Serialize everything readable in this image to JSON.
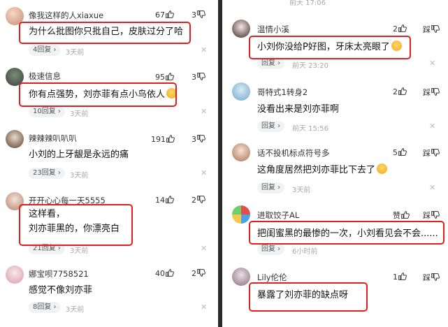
{
  "left": {
    "comments": [
      {
        "user": "像我这样的人xiaxue",
        "content": "为什么批图你只批自己，皮肤过分了哈",
        "replies": "4回复",
        "time": "3天前",
        "likes": "67",
        "dislikes": "3"
      },
      {
        "user": "极速信息",
        "content": "你有点强势，刘亦菲有点小鸟依人",
        "replies": "10回复",
        "time": "3天前",
        "likes": "95",
        "dislikes": "3"
      },
      {
        "user": "辣辣辣叭叭叭",
        "content": "小刘的上牙龈是永远的痛",
        "replies": "23回复",
        "time": "3天前",
        "likes": "191",
        "dislikes": "3"
      },
      {
        "user": "开开心心每一天5555",
        "content_line1": "这样看，",
        "content_line2": "刘亦菲黑的，你漂亮白",
        "replies": "21回复",
        "time": "3天前",
        "likes": "14",
        "dislikes": "2"
      },
      {
        "user": "娜宝呗7758521",
        "content": "感觉不像刘亦菲",
        "replies": "8回复",
        "time": "3天前",
        "likes": "40",
        "dislikes": "2"
      }
    ]
  },
  "right": {
    "top_time": "前天 17:06",
    "comments": [
      {
        "user": "温情小溪",
        "content": "小刘你没给P好图，牙床太亮眼了",
        "replies": "回复",
        "time": "前天 23:20",
        "likes": "2",
        "dislikes": "踩"
      },
      {
        "user": "哥特式1转身2",
        "content": "没看出来是刘亦菲啊",
        "replies": "回复",
        "time": "前天 15:56",
        "likes": "2",
        "dislikes": "踩"
      },
      {
        "user": "话不投机标点符号多",
        "content": "这角度居然把刘亦菲比下去了",
        "replies": "回复",
        "time": "3天前",
        "likes": "5",
        "dislikes": "踩"
      },
      {
        "user": "进取饺子AL",
        "content": "把闺蜜黑的最惨的一次，小刘看见会不会......",
        "replies": "回复",
        "time": "6小时前",
        "likes": "赞",
        "dislikes": "踩"
      },
      {
        "user": "Lily伦伦",
        "content": "暴露了刘亦菲的缺点呀",
        "replies": "",
        "time": "",
        "likes": "1",
        "dislikes": "踩"
      }
    ]
  },
  "colors": {
    "highlight": "#e01f1f",
    "divider": "#2b2b2b",
    "pill": "#f1f2f4"
  }
}
